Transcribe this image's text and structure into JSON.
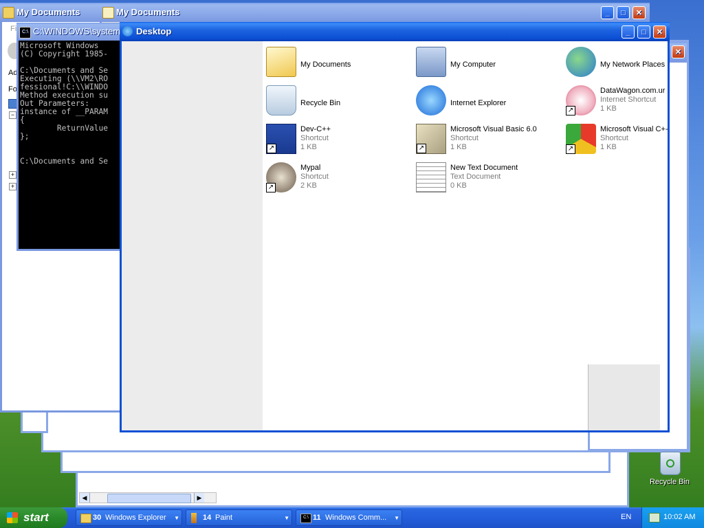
{
  "windows": {
    "mydocs_back": {
      "title": "My Documents",
      "partial_label_1": "Fi",
      "partial_label_2": "Ad",
      "partial_label_3": "Fo"
    },
    "mydocs_mid": {
      "title": "My Documents"
    },
    "cmd": {
      "title": "C:\\WINDOWS\\system",
      "lines": [
        "Microsoft Windows",
        "(C) Copyright 1985-",
        "",
        "C:\\Documents and Se",
        "Executing (\\\\VM2\\RO",
        "fessional!C:\\\\WINDO",
        "Method execution su",
        "Out Parameters:",
        "instance of __PARAM",
        "{",
        "        ReturnValue",
        "};",
        "",
        "",
        "C:\\Documents and Se"
      ]
    },
    "desktop": {
      "title": "Desktop",
      "items": [
        {
          "name": "My Documents",
          "line2": "",
          "line3": "",
          "icon": "folder-documents-icon"
        },
        {
          "name": "My Computer",
          "line2": "",
          "line3": "",
          "icon": "computer-icon"
        },
        {
          "name": "My Network Places",
          "line2": "",
          "line3": "",
          "icon": "network-places-icon"
        },
        {
          "name": "Recycle Bin",
          "line2": "",
          "line3": "",
          "icon": "recycle-bin-icon"
        },
        {
          "name": "Internet Explorer",
          "line2": "",
          "line3": "",
          "icon": "internet-explorer-icon"
        },
        {
          "name": "DataWagon.com.ur",
          "line2": "Internet Shortcut",
          "line3": "1 KB",
          "icon": "internet-shortcut-icon"
        },
        {
          "name": "Dev-C++",
          "line2": "Shortcut",
          "line3": "1 KB",
          "icon": "devcpp-icon"
        },
        {
          "name": "Microsoft Visual Basic 6.0",
          "line2": "Shortcut",
          "line3": "1 KB",
          "icon": "visual-basic-icon"
        },
        {
          "name": "Microsoft Visual C+-",
          "line2": "Shortcut",
          "line3": "1 KB",
          "icon": "visual-cpp-icon"
        },
        {
          "name": "Mypal",
          "line2": "Shortcut",
          "line3": "2 KB",
          "icon": "mypal-icon"
        },
        {
          "name": "New Text Document",
          "line2": "Text Document",
          "line3": "0 KB",
          "icon": "text-document-icon"
        }
      ]
    }
  },
  "desktop_icons": {
    "recycle_bin_label": "Recycle Bin"
  },
  "taskbar": {
    "start_label": "start",
    "buttons": [
      {
        "count": "30",
        "label": "Windows Explorer",
        "icon": "folder-icon"
      },
      {
        "count": "14",
        "label": "Paint",
        "icon": "paint-icon"
      },
      {
        "count": "11",
        "label": "Windows Comm...",
        "icon": "cmd-icon"
      }
    ],
    "language": "EN",
    "clock": "10:02 AM"
  },
  "colors": {
    "titlebar_active": "#0a4fd4",
    "titlebar_inactive": "#7a98e0",
    "desktop_sky": "#5a8fe0",
    "desktop_grass": "#2f7a1d"
  }
}
